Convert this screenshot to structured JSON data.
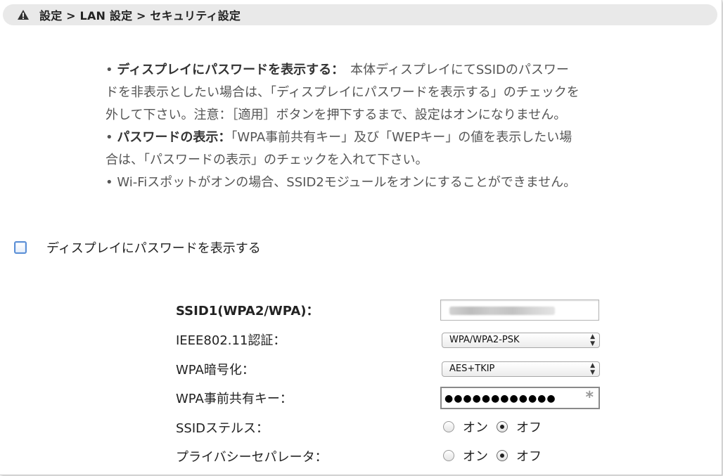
{
  "breadcrumb": {
    "text": "設定 > LAN 設定 > セキュリティ設定"
  },
  "notes": [
    {
      "bold": "ディスプレイにパスワードを表示する：",
      "text": "　本体ディスプレイにてSSIDのパスワー"
    },
    {
      "bold": "",
      "text": "ドを非表示としたい場合は、「ディスプレイにパスワードを表示する」のチェックを"
    },
    {
      "bold": "",
      "text": "外して下さい。注意：［適用］ボタンを押下するまで、設定はオンになりません。"
    },
    {
      "bold": "パスワードの表示：",
      "text": "「WPA事前共有キー」及び「WEPキー」の値を表示したい場"
    },
    {
      "bold": "",
      "text": "合は、「パスワードの表示」のチェックを入れて下さい。"
    },
    {
      "bold": "",
      "text": "Wi-Fiスポットがオンの場合、SSID2モジュールをオンにすることができません。"
    }
  ],
  "bullet": "•",
  "display_password": {
    "label": "ディスプレイにパスワードを表示する",
    "checked": false
  },
  "form": {
    "ssid": {
      "label": "SSID1(WPA2/WPA)：",
      "value_blurred": true
    },
    "auth": {
      "label": "IEEE802.11認証：",
      "value": "WPA/WPA2-PSK"
    },
    "encryption": {
      "label": "WPA暗号化：",
      "value": "AES+TKIP"
    },
    "psk": {
      "label": "WPA事前共有キー：",
      "masked": "●●●●●●●●●●●●",
      "reveal_icon": "*"
    },
    "ssid_stealth": {
      "label": "SSIDステルス：",
      "on": "オン",
      "off": "オフ",
      "selected": "off"
    },
    "privacy_separator": {
      "label": "プライバシーセパレータ：",
      "on": "オン",
      "off": "オフ",
      "selected": "off"
    }
  },
  "icons": {
    "breadcrumb": "warning-triangle-icon",
    "select_arrow": "updown-arrow-icon"
  },
  "colors": {
    "checkbox_border": "#5b8fd6",
    "breadcrumb_bg": "#e9e9e9"
  }
}
